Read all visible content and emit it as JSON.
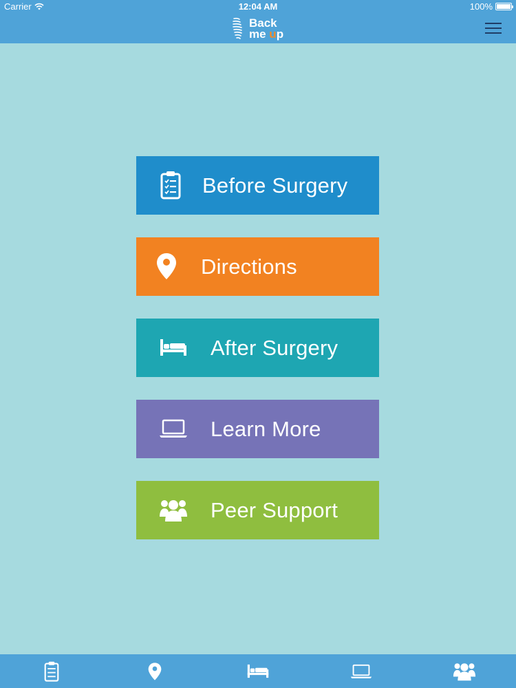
{
  "status_bar": {
    "carrier": "Carrier",
    "time": "12:04 AM",
    "battery": "100%"
  },
  "header": {
    "logo_line1": "Back",
    "logo_line2_prefix": "me ",
    "logo_line2_accent": "u",
    "logo_line2_suffix": "p",
    "menu_icon": "hamburger-menu-icon"
  },
  "colors": {
    "background": "#a6dadf",
    "bar": "#4fa3d8",
    "accent_orange": "#f28b2a"
  },
  "menu": [
    {
      "label": "Before Surgery",
      "icon": "clipboard-icon",
      "color": "#1f8dcb"
    },
    {
      "label": "Directions",
      "icon": "map-pin-icon",
      "color": "#f28221"
    },
    {
      "label": "After Surgery",
      "icon": "bed-icon",
      "color": "#1ea6b2"
    },
    {
      "label": "Learn More",
      "icon": "laptop-icon",
      "color": "#7673b7"
    },
    {
      "label": "Peer Support",
      "icon": "people-icon",
      "color": "#8fbe3f"
    }
  ],
  "tab_bar": {
    "items": [
      {
        "icon": "clipboard-icon"
      },
      {
        "icon": "map-pin-icon"
      },
      {
        "icon": "bed-icon"
      },
      {
        "icon": "laptop-icon"
      },
      {
        "icon": "people-icon"
      }
    ]
  }
}
